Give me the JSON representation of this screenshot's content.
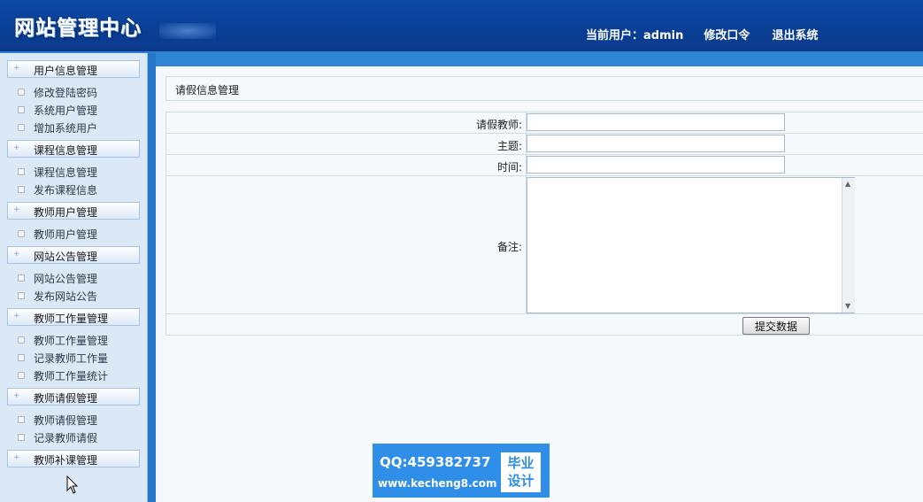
{
  "header": {
    "logo": "网站管理中心",
    "current_user_label": "当前用户：",
    "current_user": "admin",
    "change_password": "修改口令",
    "logout": "退出系统"
  },
  "sidebar": {
    "groups": [
      {
        "label": "用户信息管理",
        "items": [
          "修改登陆密码",
          "系统用户管理",
          "增加系统用户"
        ]
      },
      {
        "label": "课程信息管理",
        "items": [
          "课程信息管理",
          "发布课程信息"
        ]
      },
      {
        "label": "教师用户管理",
        "items": [
          "教师用户管理"
        ]
      },
      {
        "label": "网站公告管理",
        "items": [
          "网站公告管理",
          "发布网站公告"
        ]
      },
      {
        "label": "教师工作量管理",
        "items": [
          "教师工作量管理",
          "记录教师工作量",
          "教师工作量统计"
        ]
      },
      {
        "label": "教师请假管理",
        "items": [
          "教师请假管理",
          "记录教师请假"
        ]
      },
      {
        "label": "教师补课管理",
        "items": []
      }
    ]
  },
  "main": {
    "title": "请假信息管理",
    "form": {
      "teacher_label": "请假教师:",
      "teacher_value": "",
      "subject_label": "主题:",
      "subject_value": "",
      "time_label": "时间:",
      "time_value": "",
      "remark_label": "备注:",
      "remark_value": "",
      "submit_label": "提交数据"
    }
  },
  "watermark": {
    "qq": "QQ:459382737",
    "url": "www.kecheng8.com",
    "badge_line1": "毕业",
    "badge_line2": "设计"
  },
  "colors": {
    "header_bg": "#0a3f96",
    "sidebar_bg": "#dbe8f6",
    "divider": "#2376c8",
    "main_bg": "#f5f9fb",
    "watermark_bg": "#2f8ee8"
  }
}
